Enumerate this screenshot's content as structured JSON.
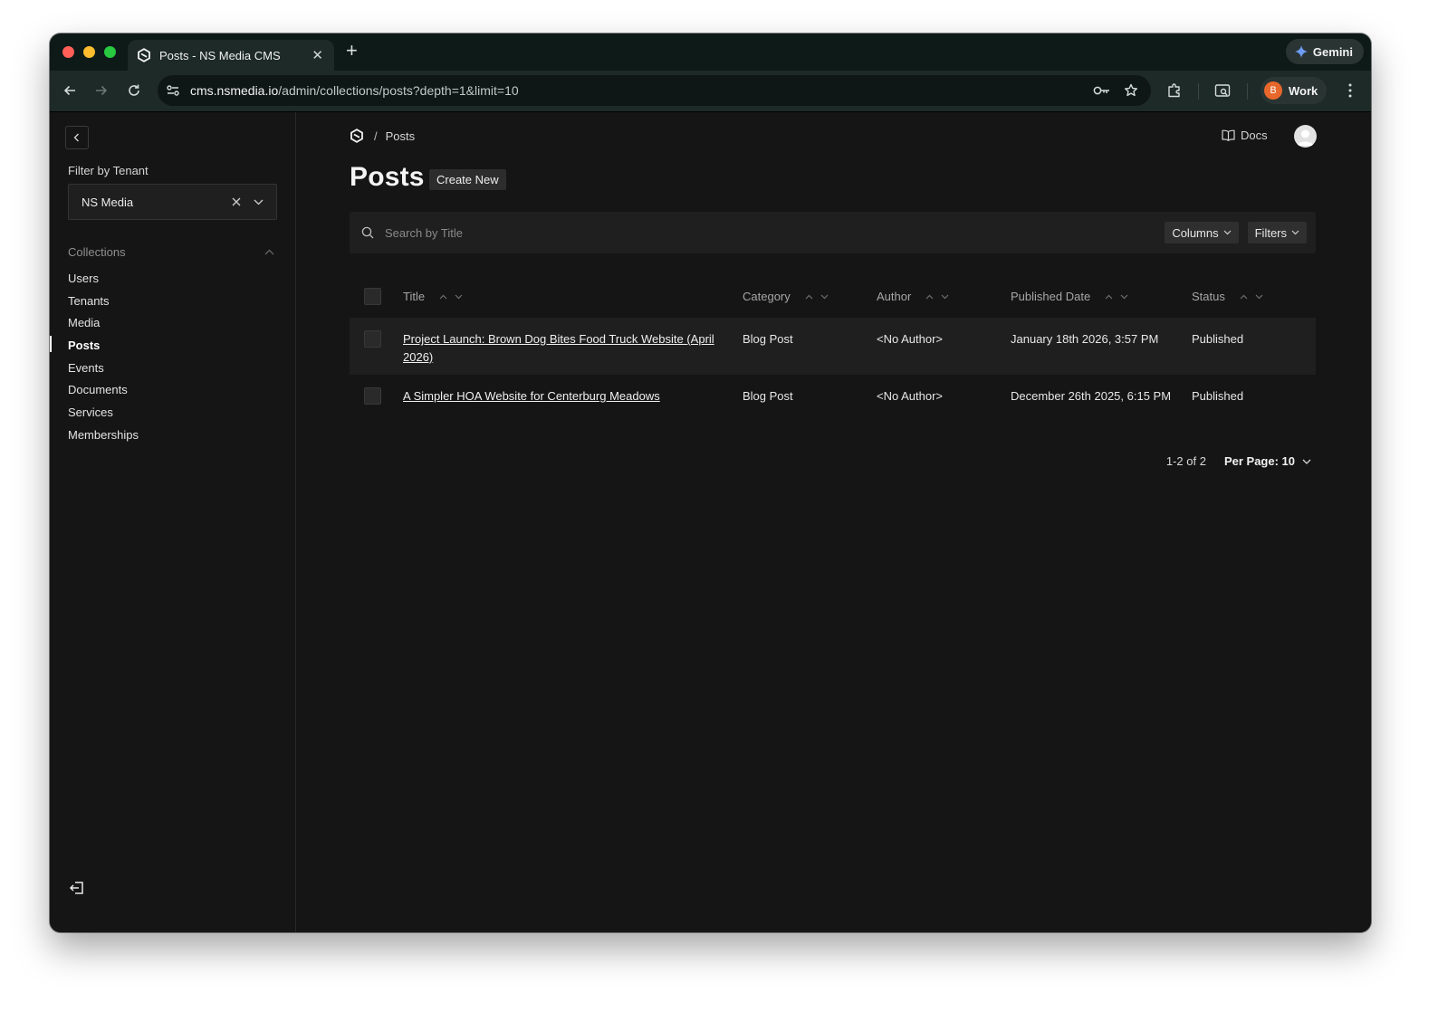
{
  "browser": {
    "tab_title": "Posts - NS Media CMS",
    "new_tab": "+",
    "gemini_label": "Gemini",
    "url_host": "cms.nsmedia.io",
    "url_path": "/admin/collections/posts?depth=1&limit=10",
    "profile_initial": "B",
    "profile_label": "Work"
  },
  "sidebar": {
    "filter_label": "Filter by Tenant",
    "tenant_value": "NS Media",
    "collections_label": "Collections",
    "items": [
      {
        "label": "Users"
      },
      {
        "label": "Tenants"
      },
      {
        "label": "Media"
      },
      {
        "label": "Posts",
        "active": true
      },
      {
        "label": "Events"
      },
      {
        "label": "Documents"
      },
      {
        "label": "Services"
      },
      {
        "label": "Memberships"
      }
    ]
  },
  "header": {
    "breadcrumb_sep": "/",
    "breadcrumb_current": "Posts",
    "docs_label": "Docs"
  },
  "main": {
    "title": "Posts",
    "create_new": "Create New",
    "search_placeholder": "Search by Title",
    "columns_label": "Columns",
    "filters_label": "Filters"
  },
  "table": {
    "columns": [
      "Title",
      "Category",
      "Author",
      "Published Date",
      "Status"
    ],
    "rows": [
      {
        "title": "Project Launch: Brown Dog Bites Food Truck Website (April 2026)",
        "category": "Blog Post",
        "author": "<No Author>",
        "published_date": "January 18th 2026, 3:57 PM",
        "status": "Published"
      },
      {
        "title": "A Simpler HOA Website for Centerburg Meadows",
        "category": "Blog Post",
        "author": "<No Author>",
        "published_date": "December 26th 2025, 6:15 PM",
        "status": "Published"
      }
    ]
  },
  "pagination": {
    "range": "1-2 of 2",
    "per_page": "Per Page: 10"
  },
  "colors": {
    "background": "#151515",
    "surface": "#1f1f1f",
    "browser_chrome": "#1d2a28",
    "profile_avatar": "#e8672b"
  }
}
